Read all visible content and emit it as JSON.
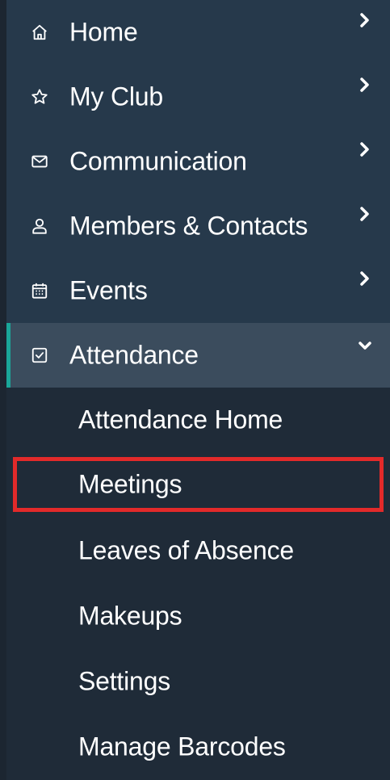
{
  "sidebar": {
    "items": [
      {
        "label": "Home",
        "icon": "home-icon",
        "expanded": false
      },
      {
        "label": "My Club",
        "icon": "star-icon",
        "expanded": false
      },
      {
        "label": "Communication",
        "icon": "mail-icon",
        "expanded": false
      },
      {
        "label": "Members & Contacts",
        "icon": "person-icon",
        "expanded": false
      },
      {
        "label": "Events",
        "icon": "calendar-icon",
        "expanded": false
      },
      {
        "label": "Attendance",
        "icon": "checkbox-icon",
        "expanded": true,
        "active": true
      }
    ],
    "submenu": [
      {
        "label": "Attendance Home"
      },
      {
        "label": "Meetings",
        "highlighted": true
      },
      {
        "label": "Leaves of Absence"
      },
      {
        "label": "Makeups"
      },
      {
        "label": "Settings"
      },
      {
        "label": "Manage Barcodes"
      }
    ]
  },
  "colors": {
    "sidebar_bg": "#26394b",
    "active_item_bg": "#3b4c5d",
    "submenu_bg": "#1f2b38",
    "active_accent": "#1aa79a",
    "highlight_border": "#e22a2a",
    "text": "#ffffff"
  }
}
